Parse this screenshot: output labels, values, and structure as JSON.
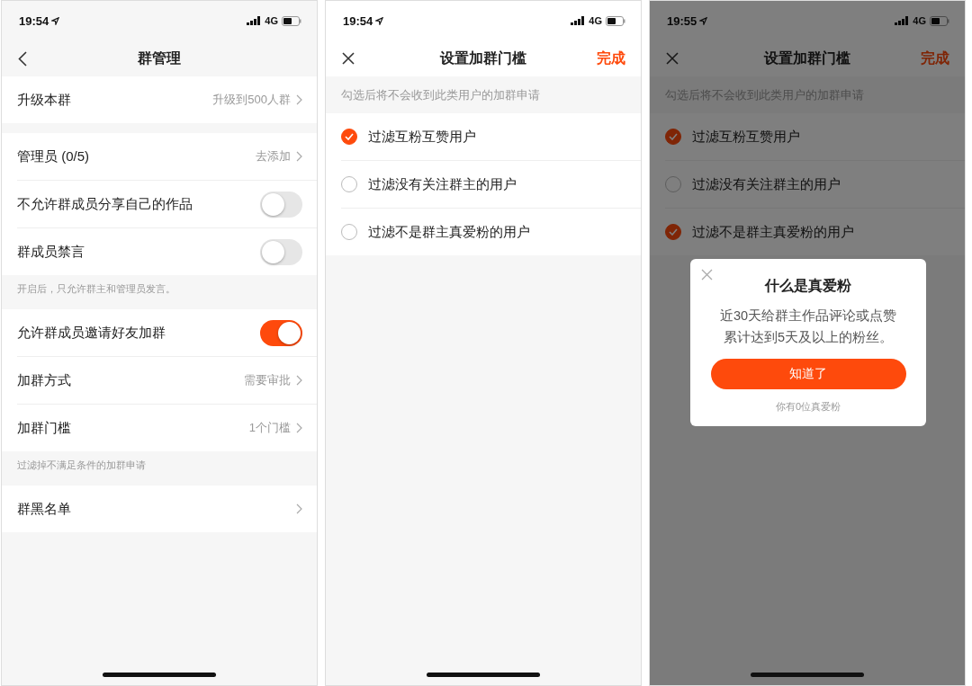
{
  "screens": [
    {
      "kind": "settings",
      "status_bar": {
        "time": "19:54",
        "network": "4G"
      },
      "nav": {
        "leading": {
          "kind": "back"
        },
        "title": "群管理"
      },
      "groups": [
        {
          "rows": [
            {
              "kind": "link",
              "label": "升级本群",
              "value": "升级到500人群"
            }
          ]
        },
        {
          "rows": [
            {
              "kind": "link",
              "label": "管理员 (0/5)",
              "value": "去添加"
            },
            {
              "kind": "toggle",
              "label": "不允许群成员分享自己的作品",
              "on": false
            },
            {
              "kind": "toggle",
              "label": "群成员禁言",
              "on": false
            }
          ],
          "footnote": "开启后，只允许群主和管理员发言。"
        },
        {
          "rows": [
            {
              "kind": "toggle",
              "label": "允许群成员邀请好友加群",
              "on": true
            },
            {
              "kind": "link",
              "label": "加群方式",
              "value": "需要审批"
            },
            {
              "kind": "link",
              "label": "加群门槛",
              "value": "1个门槛"
            }
          ],
          "footnote": "过滤掉不满足条件的加群申请"
        },
        {
          "rows": [
            {
              "kind": "link",
              "label": "群黑名单"
            }
          ]
        }
      ]
    },
    {
      "kind": "filters",
      "status_bar": {
        "time": "19:54",
        "network": "4G"
      },
      "nav": {
        "leading": {
          "kind": "close"
        },
        "title": "设置加群门槛",
        "action": "完成"
      },
      "hint": "勾选后将不会收到此类用户的加群申请",
      "options": [
        {
          "label": "过滤互粉互赞用户",
          "checked": true
        },
        {
          "label": "过滤没有关注群主的用户",
          "checked": false
        },
        {
          "label": "过滤不是群主真爱粉的用户",
          "checked": false
        }
      ]
    },
    {
      "kind": "filters",
      "status_bar": {
        "time": "19:55",
        "network": "4G"
      },
      "nav": {
        "leading": {
          "kind": "close"
        },
        "title": "设置加群门槛",
        "action": "完成"
      },
      "hint": "勾选后将不会收到此类用户的加群申请",
      "options": [
        {
          "label": "过滤互粉互赞用户",
          "checked": true
        },
        {
          "label": "过滤没有关注群主的用户",
          "checked": false
        },
        {
          "label": "过滤不是群主真爱粉的用户",
          "checked": true
        }
      ],
      "dialog": {
        "title": "什么是真爱粉",
        "message": "近30天给群主作品评论或点赞累计达到5天及以上的粉丝。",
        "button": "知道了",
        "footer": "你有0位真爱粉"
      }
    }
  ]
}
